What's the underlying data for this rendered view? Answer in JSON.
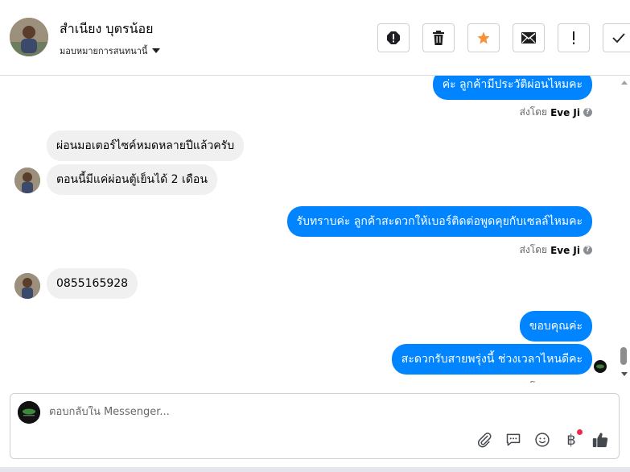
{
  "header": {
    "contact_name": "สำเนียง บุตรน้อย",
    "assign_label": "มอบหมายการสนทนานี้",
    "toolbar": [
      {
        "name": "report-spam-button",
        "icon": "exclamation-octagon-icon"
      },
      {
        "name": "delete-button",
        "icon": "trash-icon"
      },
      {
        "name": "star-button",
        "icon": "star-icon",
        "color": "#f7923b"
      },
      {
        "name": "mark-unread-button",
        "icon": "envelope-icon"
      },
      {
        "name": "follow-up-button",
        "icon": "exclamation-icon"
      },
      {
        "name": "mark-done-button",
        "icon": "checkmark-icon"
      }
    ]
  },
  "messages": {
    "m1": "ค่ะ ลูกค้ามีประวัติผ่อนไหมคะ",
    "m2": "ผ่อนมอเตอร์ไซค์หมดหลายปีแล้วครับ",
    "m3": "ตอนนี้มีแค่ผ่อนตู้เย็นได้ 2 เดือน",
    "m4": "รับทราบค่ะ ลูกค้าสะดวกให้เบอร์ติดต่อพูดคุยกับเซลล์ไหมคะ",
    "m5": "0855165928",
    "m6": "ขอบคุณค่ะ",
    "m7": "สะดวกรับสายพรุ่งนี้ ช่วงเวลาไหนดีคะ"
  },
  "sent_by": {
    "prefix": "ส่งโดย",
    "agent": "Eve Ji",
    "help_glyph": "?"
  },
  "composer": {
    "placeholder": "ตอบกลับใน Messenger...",
    "actions": [
      "paperclip-icon",
      "saved-reply-icon",
      "emoji-icon",
      "payment-icon",
      "like-icon"
    ],
    "payment_glyph": "฿"
  },
  "colors": {
    "outgoing_bubble": "#0084ff",
    "incoming_bubble": "#f0f0f0",
    "accent_star": "#f7923b"
  }
}
